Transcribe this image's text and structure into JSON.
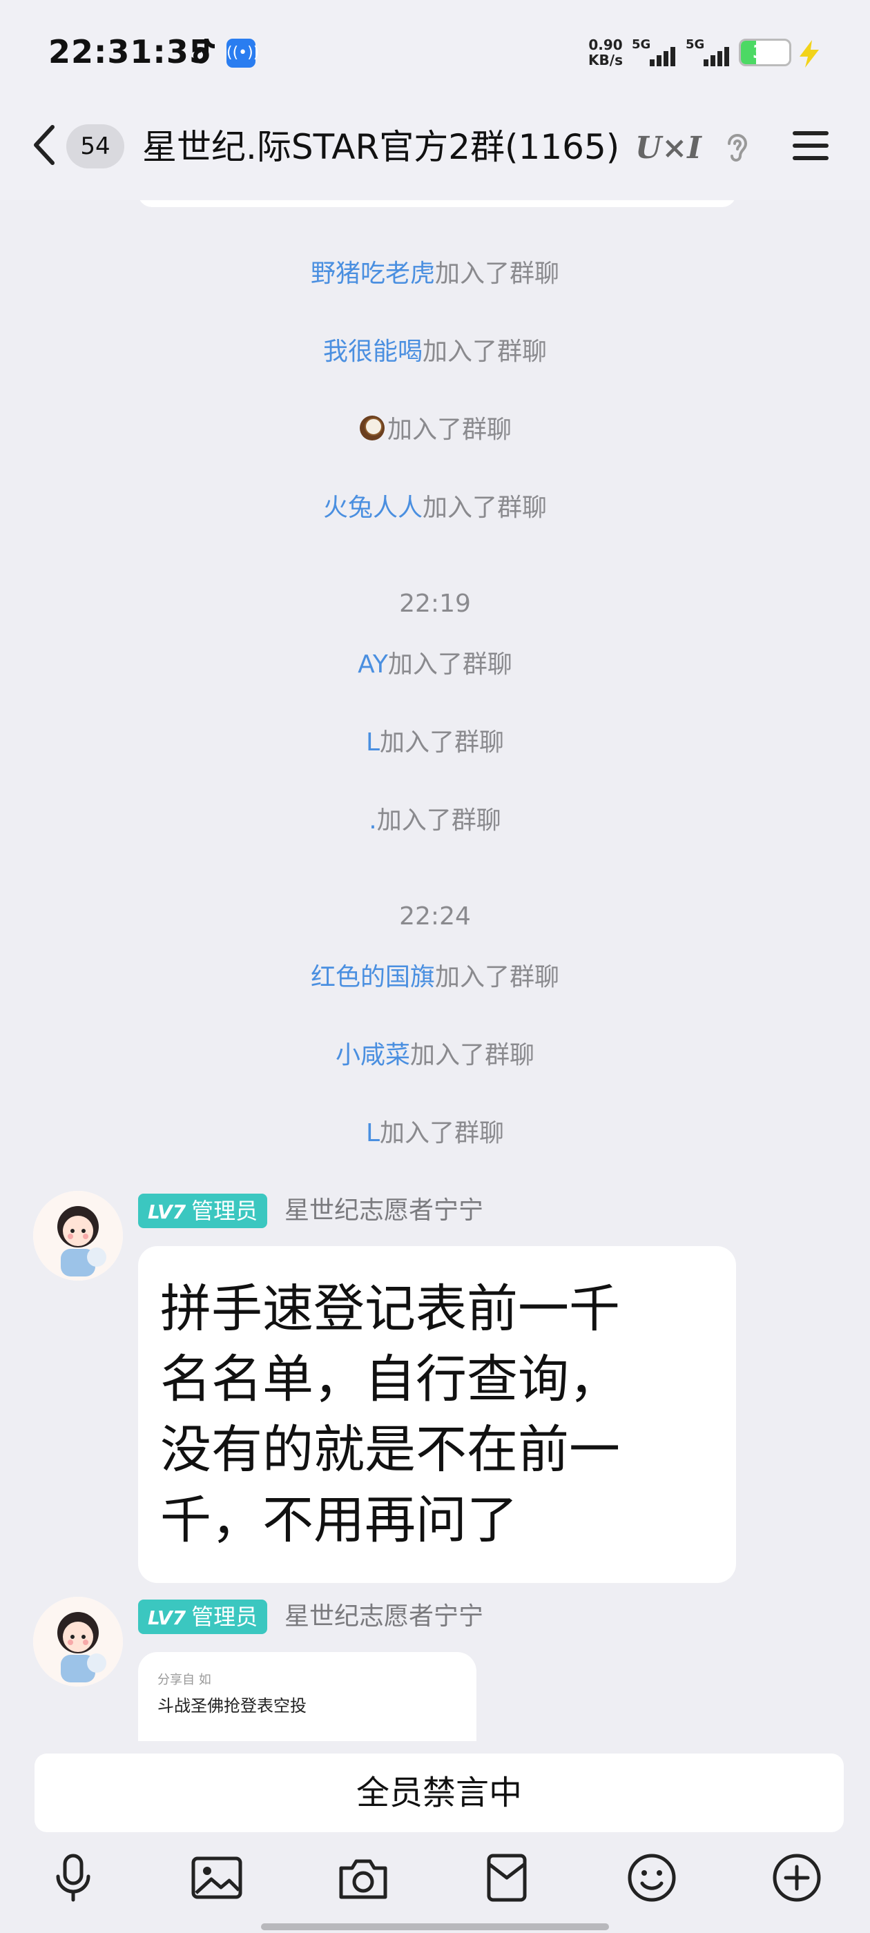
{
  "status_bar": {
    "time": "22:31:35",
    "net_speed_value": "0.90",
    "net_speed_unit": "KB/s",
    "sim1_label": "5G",
    "sim2_label": "5G",
    "battery_level": "32",
    "battery_fraction": 0.32,
    "battery_color": "#4cd964"
  },
  "header": {
    "back_icon": "chevron-left-icon",
    "unread_count": "54",
    "group_title": "星世纪.际STAR官方2群(1165)",
    "badge_text": "U×I",
    "ear_icon": "ear-icon",
    "menu_icon": "menu-icon"
  },
  "system_events": [
    {
      "name": "野猪吃老虎",
      "suffix": "加入了群聊"
    },
    {
      "name": "我很能喝",
      "suffix": "加入了群聊"
    },
    {
      "name": "",
      "suffix": "加入了群聊",
      "icon": "coconut-icon"
    },
    {
      "name": "火兔人人",
      "suffix": "加入了群聊"
    },
    {
      "time": "22:19"
    },
    {
      "name": "AY",
      "suffix": "加入了群聊"
    },
    {
      "name": "L",
      "suffix": "加入了群聊"
    },
    {
      "name": ".",
      "suffix": "加入了群聊"
    },
    {
      "time": "22:24"
    },
    {
      "name": "红色的国旗",
      "suffix": "加入了群聊"
    },
    {
      "name": "小咸菜",
      "suffix": "加入了群聊"
    },
    {
      "name": "L",
      "suffix": "加入了群聊"
    }
  ],
  "messages": [
    {
      "level": "LV7",
      "role": "管理员",
      "sender": "星世纪志愿者宁宁",
      "lines": [
        "拼手速登记表前一千",
        "名名单，自行查询，",
        "没有的就是不在前一",
        "千，不用再问了"
      ]
    },
    {
      "level": "LV7",
      "role": "管理员",
      "sender": "星世纪志愿者宁宁",
      "card_small": "分享自 如",
      "card_title": "斗战圣佛抢登表空投"
    }
  ],
  "footer": {
    "muted_text": "全员禁言中",
    "tools": [
      "microphone-icon",
      "image-icon",
      "camera-icon",
      "red-packet-icon",
      "emoji-icon",
      "plus-icon"
    ]
  },
  "colors": {
    "name_link": "#4a8fe0",
    "level_tag": "#3bc7c0",
    "background": "#eeeef3"
  }
}
